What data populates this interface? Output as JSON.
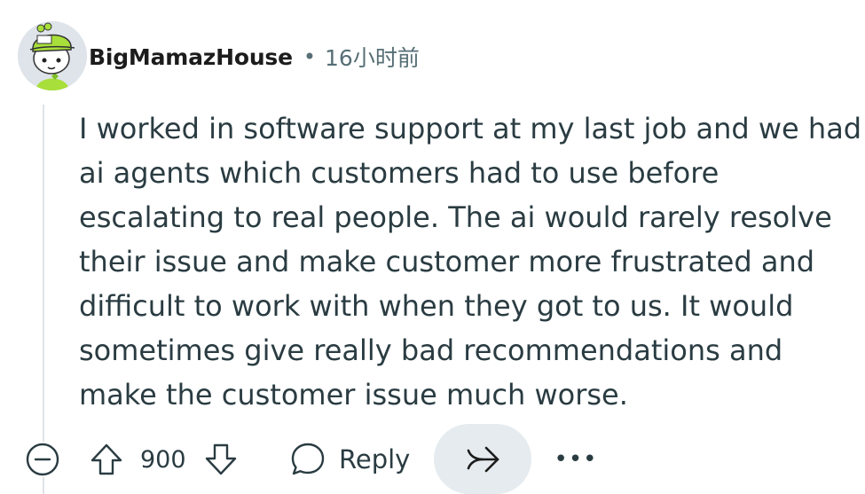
{
  "comment": {
    "username": "BigMamazHouse",
    "separator": "•",
    "timestamp": "16小时前",
    "body_lines": [
      "I worked in software support at my last job and we had",
      "ai agents which customers had to use before",
      "escalating to real people. The ai would rarely resolve",
      "their issue and make customer more frustrated and",
      "difficult to work with when they got to us. It would",
      "sometimes give really bad recommendations and",
      "make the customer issue much worse."
    ]
  },
  "actions": {
    "score": "900",
    "reply_label": "Reply",
    "more_label": "•••"
  },
  "icons": {
    "collapse": "minus-circle-icon",
    "upvote": "arrow-up-icon",
    "downvote": "arrow-down-icon",
    "reply": "speech-bubble-icon",
    "share": "share-arrow-icon",
    "more": "ellipsis-icon"
  },
  "colors": {
    "text": "#2a3c42",
    "muted": "#576f76",
    "share_bg": "#e5ebee",
    "avatar_hat": "#a8df3a"
  }
}
